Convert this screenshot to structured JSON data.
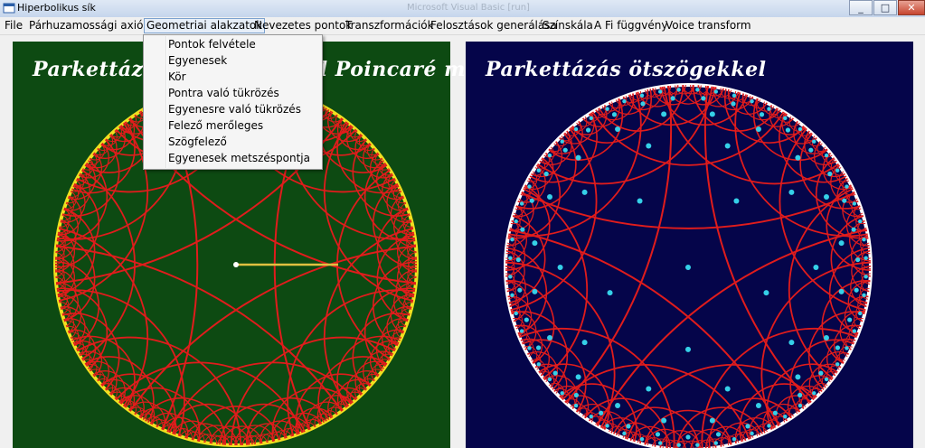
{
  "window": {
    "title": "Hiperbolikus sík",
    "background_ghost_text": "Microsoft Visual Basic [run]",
    "controls": [
      "minimize",
      "maximize",
      "close"
    ]
  },
  "menubar": {
    "items": [
      "File",
      "Párhuzamossági axióma",
      "Geometriai alakzatok",
      "Nevezetes pontok",
      "Transzformációk",
      "Felosztások generálása",
      "Színskála",
      "A Fi függvény",
      "Voice transform"
    ],
    "open_item": "Geometriai alakzatok"
  },
  "dropdown": {
    "items": [
      "Pontok felvétele",
      "Egyenesek",
      "Kör",
      "Pontra való tükrözés",
      "Egyenesre való tükrözés",
      "Felező merőleges",
      "Szögfelező",
      "Egyenesek metszéspontja"
    ]
  },
  "panels": {
    "left": {
      "title": "Parkettázás hatszögekkel Poincaré modellen",
      "background_color": "#0d4a12",
      "edge_color": "#e01c1c",
      "boundary_color": "#f0e020",
      "segment_color": "#e0c040"
    },
    "right": {
      "title": "Parkettázás ötszögekkel",
      "background_color": "#05054a",
      "edge_color": "#e01c1c",
      "boundary_color": "#ffffff",
      "dot_color": "#35d0e8"
    }
  },
  "icons": {
    "app": "app-window-icon",
    "minimize": "minimize-icon",
    "maximize": "maximize-icon",
    "close": "close-icon"
  }
}
